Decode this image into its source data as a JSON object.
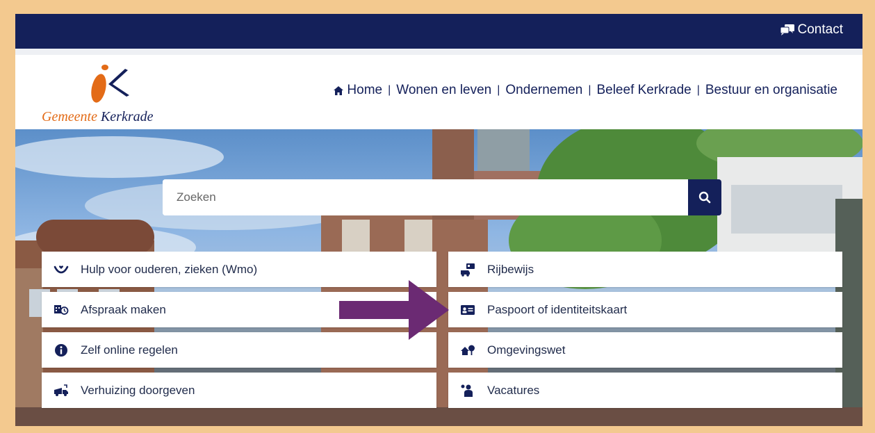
{
  "topbar": {
    "contact_label": "Contact"
  },
  "logo": {
    "text_part1": "Gemeente",
    "text_part2": "Kerkrade"
  },
  "nav": {
    "items": [
      {
        "label": "Home"
      },
      {
        "label": "Wonen en leven"
      },
      {
        "label": "Ondernemen"
      },
      {
        "label": "Beleef Kerkrade"
      },
      {
        "label": "Bestuur en organisatie"
      }
    ],
    "separator": "|"
  },
  "search": {
    "placeholder": "Zoeken"
  },
  "tiles": {
    "left": [
      {
        "label": "Hulp voor ouderen, zieken (Wmo)",
        "icon": "hands-heart-icon"
      },
      {
        "label": "Afspraak maken",
        "icon": "calendar-clock-icon"
      },
      {
        "label": "Zelf online regelen",
        "icon": "info-icon"
      },
      {
        "label": "Verhuizing doorgeven",
        "icon": "moving-truck-icon"
      }
    ],
    "right": [
      {
        "label": "Rijbewijs",
        "icon": "driver-license-icon"
      },
      {
        "label": "Paspoort of identiteitskaart",
        "icon": "id-card-icon"
      },
      {
        "label": "Omgevingswet",
        "icon": "house-tree-icon"
      },
      {
        "label": "Vacatures",
        "icon": "job-seeker-icon"
      }
    ]
  },
  "colors": {
    "brand_navy": "#14205a",
    "brand_orange": "#e36b17",
    "frame_border": "#f3c98f",
    "annotation_arrow": "#6b2a73"
  }
}
